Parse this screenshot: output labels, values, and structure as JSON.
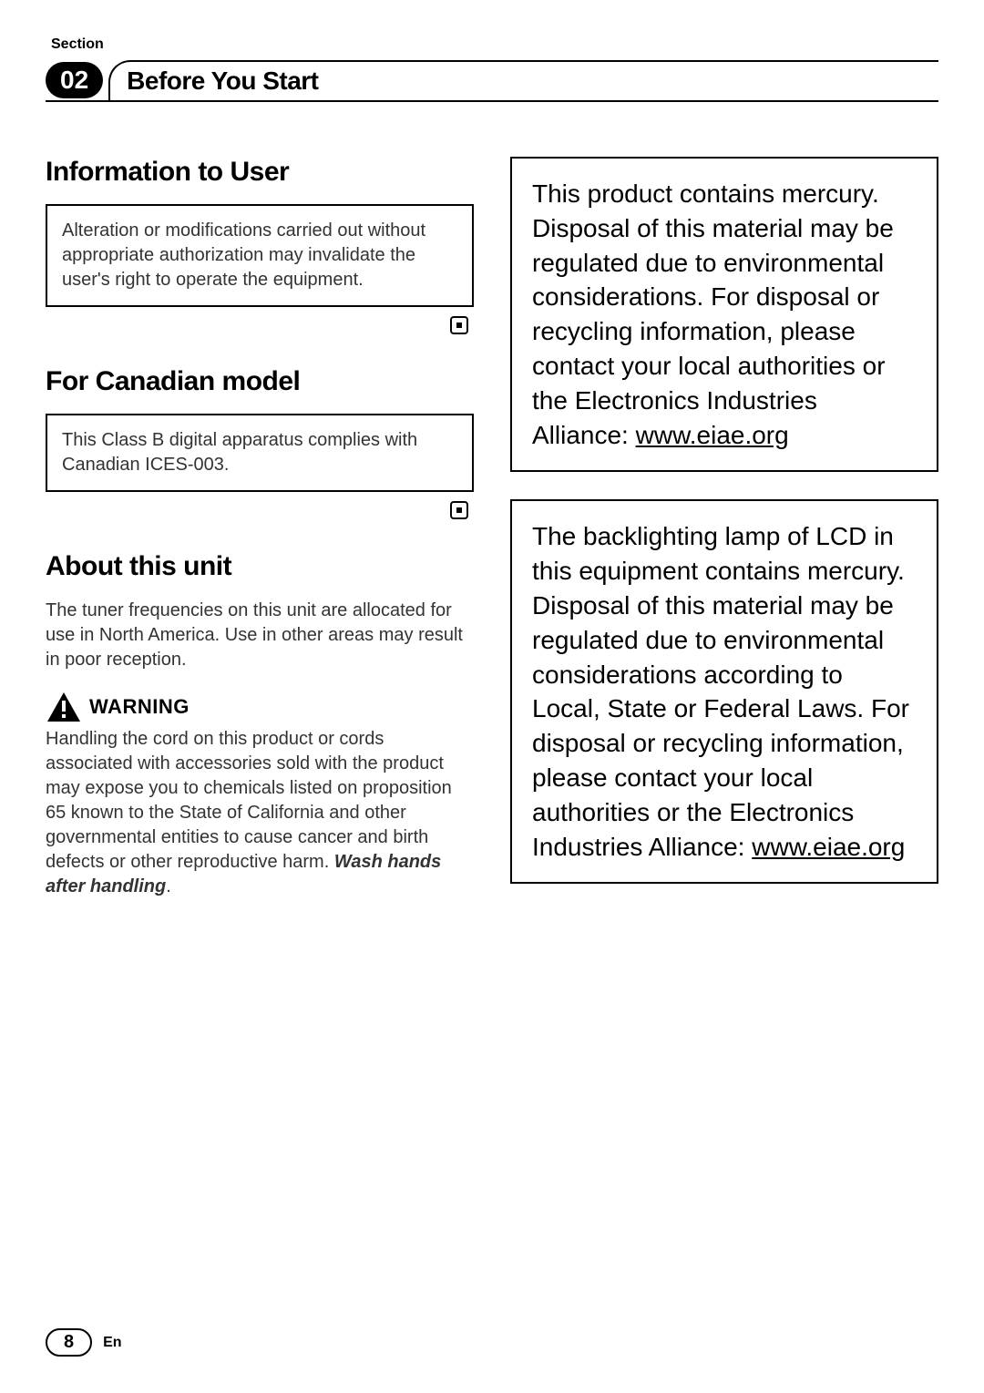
{
  "header": {
    "section_label": "Section",
    "section_number": "02",
    "title": "Before You Start"
  },
  "left": {
    "h_info": "Information to User",
    "box_info": "Alteration or modifications carried out without appropriate authorization may invalidate the user's right to operate the equipment.",
    "h_canadian": "For Canadian model",
    "box_canadian": "This Class B digital apparatus complies with Canadian ICES-003.",
    "h_about": "About this unit",
    "about_para": "The tuner frequencies on this unit are allocated for use in North America. Use in other areas may result in poor reception.",
    "warning_label": "WARNING",
    "warning_body_1": "Handling the cord on this product or cords associated with accessories sold with the product may expose you to chemicals listed on proposition 65 known to the State of California and other governmental entities to cause cancer and birth defects or other reproductive harm. ",
    "warning_body_bold": "Wash hands after handling",
    "warning_body_end": "."
  },
  "right": {
    "box1_text": "This product contains mercury. Disposal of this material may be regulated due to environmental considerations. For disposal or recycling information, please contact your local authorities or the Electronics Industries Alliance: ",
    "box1_link": "www.eiae.org",
    "box2_text": "The backlighting lamp of LCD in this equipment contains mercury. Disposal of this material may be regulated due to environmental considerations according to Local, State or Federal Laws. For disposal or recycling information, please contact your local authorities or the Electronics Industries Alliance: ",
    "box2_link": "www.eiae.org"
  },
  "footer": {
    "page": "8",
    "lang": "En"
  }
}
